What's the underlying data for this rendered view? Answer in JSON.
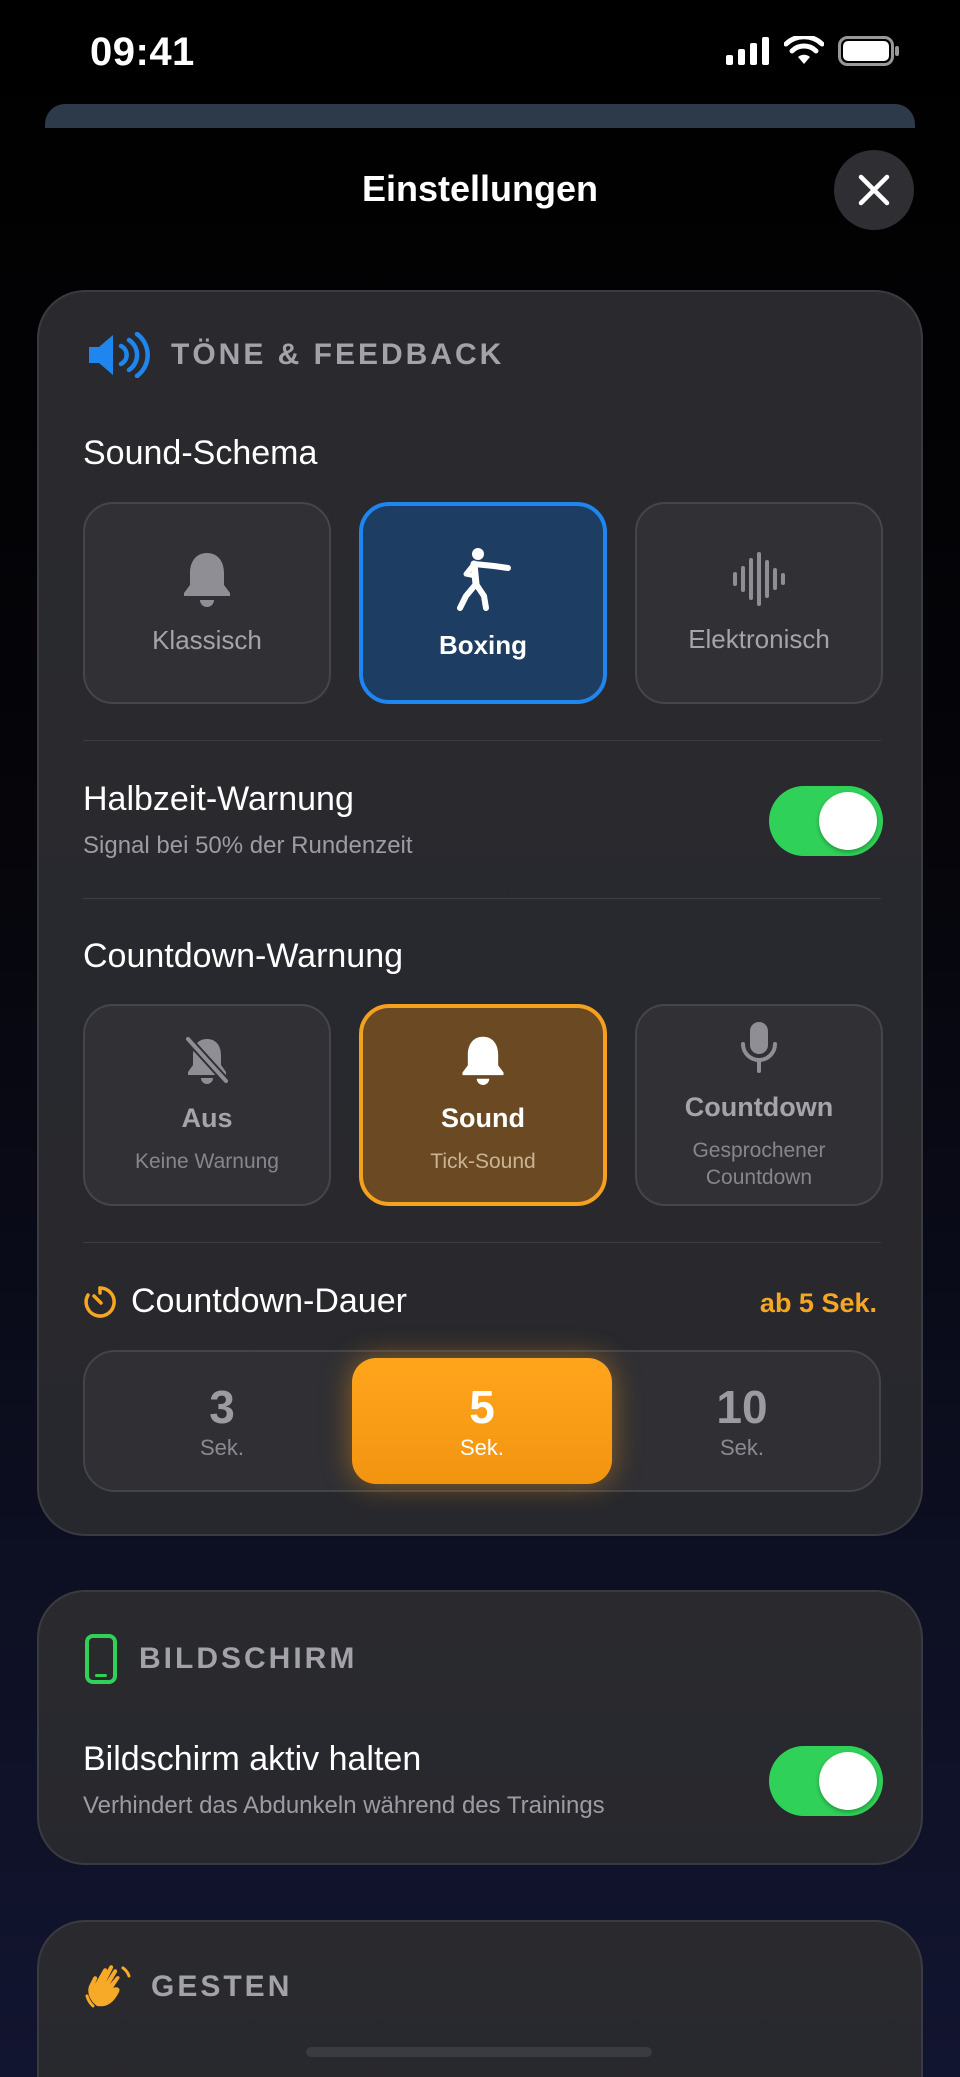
{
  "status_bar": {
    "time": "09:41"
  },
  "header": {
    "title": "Einstellungen"
  },
  "sound_section": {
    "title": "TÖNE & FEEDBACK",
    "sound_scheme_label": "Sound-Schema",
    "schemes": [
      {
        "label": "Klassisch",
        "icon": "bell-icon",
        "selected": false
      },
      {
        "label": "Boxing",
        "icon": "boxer-icon",
        "selected": true
      },
      {
        "label": "Elektronisch",
        "icon": "waveform-icon",
        "selected": false
      }
    ],
    "halftime": {
      "label": "Halbzeit-Warnung",
      "subtitle": "Signal bei 50% der Rundenzeit",
      "enabled": true
    },
    "countdown_warning_label": "Countdown-Warnung",
    "countdown_options": [
      {
        "label": "Aus",
        "subtitle": "Keine Warnung",
        "icon": "bell-slash-icon",
        "selected": false
      },
      {
        "label": "Sound",
        "subtitle": "Tick-Sound",
        "icon": "bell-icon",
        "selected": true
      },
      {
        "label": "Countdown",
        "subtitle": "Gesprochener Countdown",
        "icon": "microphone-icon",
        "selected": false
      }
    ],
    "countdown_duration": {
      "label": "Countdown-Dauer",
      "badge": "ab 5 Sek.",
      "options": [
        {
          "value": "3",
          "unit": "Sek.",
          "selected": false
        },
        {
          "value": "5",
          "unit": "Sek.",
          "selected": true
        },
        {
          "value": "10",
          "unit": "Sek.",
          "selected": false
        }
      ]
    }
  },
  "screen_section": {
    "title": "BILDSCHIRM",
    "keep_awake": {
      "label": "Bildschirm aktiv halten",
      "subtitle": "Verhindert das Abdunkeln während des Trainings",
      "enabled": true
    }
  },
  "gestures_section": {
    "title": "GESTEN"
  },
  "colors": {
    "accent_blue": "#1f86f0",
    "accent_orange": "#f5a120",
    "toggle_green": "#30d158",
    "screen_icon_green": "#30d158"
  }
}
